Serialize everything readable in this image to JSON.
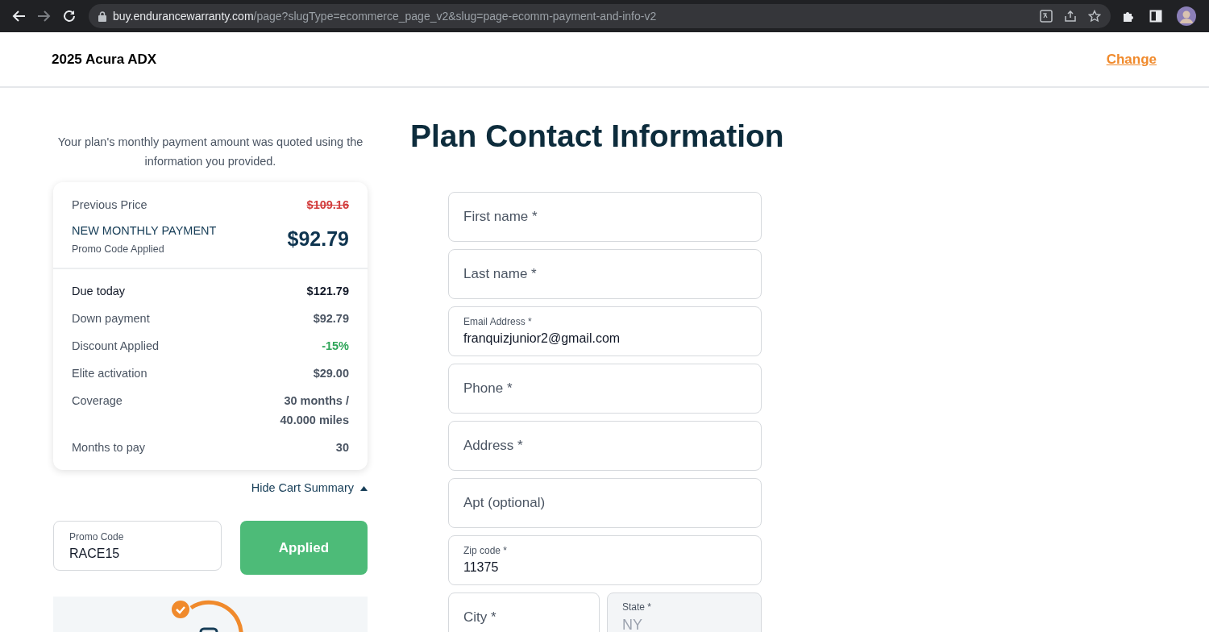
{
  "browser": {
    "url_domain": "buy.endurancewarranty.com",
    "url_path": "/page?slugType=ecommerce_page_v2&slug=page-ecomm-payment-and-info-v2",
    "forward_disabled": true
  },
  "header": {
    "vehicle": "2025 Acura ADX",
    "change_link": "Change"
  },
  "summary": {
    "note": "Your plan's monthly payment amount was quoted using the information you provided.",
    "previous_label": "Previous Price",
    "previous_price": "$109.16",
    "new_label": "NEW MONTHLY PAYMENT",
    "new_sublabel": "Promo Code Applied",
    "new_price": "$92.79",
    "rows": [
      {
        "kind": "total",
        "label": "Due today",
        "value": "$121.79"
      },
      {
        "kind": "line",
        "label": "Down payment",
        "value": "$92.79"
      },
      {
        "kind": "discount",
        "label": "Discount Applied",
        "value": "-15%"
      },
      {
        "kind": "line",
        "label": "Elite activation",
        "value": "$29.00"
      },
      {
        "kind": "line",
        "label": "Coverage",
        "value": "30 months / 40.000 miles"
      },
      {
        "kind": "line",
        "label": "Months to pay",
        "value": "30"
      }
    ],
    "toggle": "Hide Cart Summary",
    "expanded": true
  },
  "promo": {
    "label": "Promo Code",
    "value": "RACE15",
    "button": "Applied"
  },
  "form": {
    "title": "Plan Contact Information",
    "fields": [
      {
        "placeholder": "First name *",
        "disabled": false
      },
      {
        "placeholder": "Last name *",
        "disabled": false
      },
      {
        "label": "Email Address *",
        "value": "franquizjunior2@gmail.com",
        "disabled": false
      },
      {
        "placeholder": "Phone *",
        "disabled": false
      },
      {
        "placeholder": "Address *",
        "disabled": false
      },
      {
        "placeholder": "Apt (optional)",
        "disabled": false
      },
      {
        "label": "Zip code *",
        "value": "11375",
        "disabled": false
      }
    ],
    "city_state": [
      {
        "placeholder": "City *",
        "disabled": false
      },
      {
        "label": "State *",
        "value": "NY",
        "disabled": true
      }
    ]
  }
}
